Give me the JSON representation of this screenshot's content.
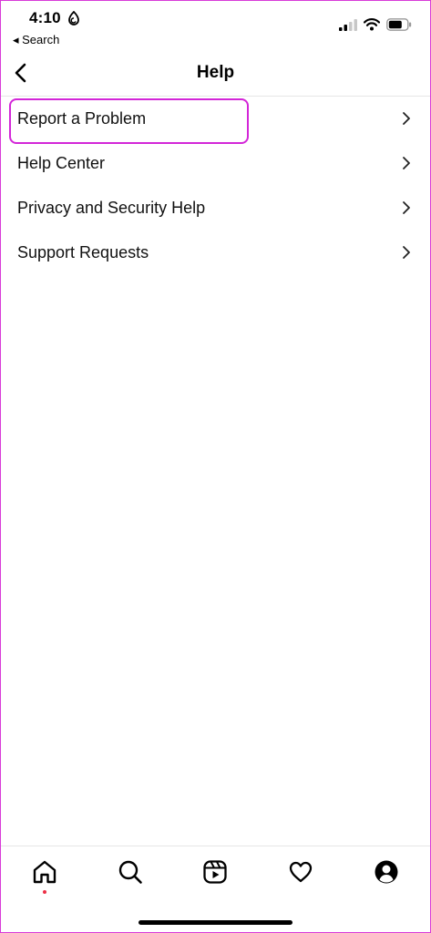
{
  "status_bar": {
    "time": "4:10",
    "back_app_label": "◂ Search"
  },
  "header": {
    "title": "Help"
  },
  "menu": {
    "items": [
      {
        "label": "Report a Problem",
        "highlighted": true
      },
      {
        "label": "Help Center"
      },
      {
        "label": "Privacy and Security Help"
      },
      {
        "label": "Support Requests"
      }
    ]
  },
  "tab_bar": {
    "tabs": [
      {
        "icon": "home-icon",
        "active": true,
        "notification_dot": true
      },
      {
        "icon": "search-icon"
      },
      {
        "icon": "reels-icon"
      },
      {
        "icon": "heart-icon"
      },
      {
        "icon": "profile-icon"
      }
    ]
  },
  "colors": {
    "highlight": "#d326d8",
    "notification_dot": "#ed2f45",
    "text": "#111111"
  }
}
